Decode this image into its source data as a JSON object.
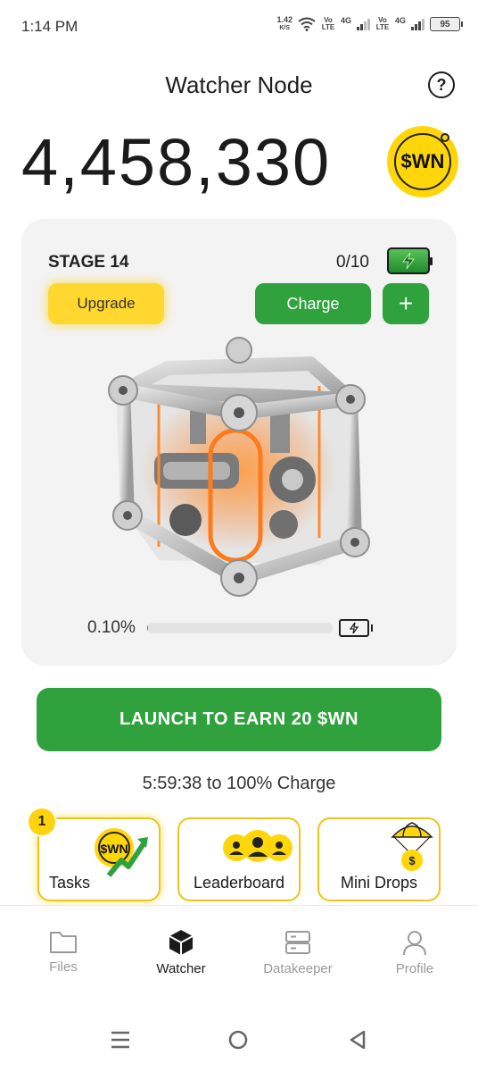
{
  "status_bar": {
    "time": "1:14 PM",
    "net_speed_value": "1.42",
    "net_speed_unit": "K/S",
    "sim1_volte": "Vo LTE",
    "sim1_network": "4G",
    "sim2_volte": "Vo LTE",
    "sim2_network": "4G",
    "battery_level": "95"
  },
  "header": {
    "title": "Watcher Node",
    "help_icon": "question-circle-icon"
  },
  "balance": {
    "amount": "4,458,330",
    "token_symbol": "$WN"
  },
  "stage_card": {
    "stage_label": "STAGE 14",
    "charges": "0/10",
    "upgrade_label": "Upgrade",
    "charge_label": "Charge",
    "plus_label": "+",
    "progress_text": "0.10%",
    "progress_value": 0.1
  },
  "launch": {
    "label": "LAUNCH TO EARN 20 $WN"
  },
  "charge_timer": "5:59:38 to 100% Charge",
  "tiles": {
    "tasks": {
      "label": "Tasks",
      "badge": "1",
      "icon_text": "$WN"
    },
    "leaderboard": {
      "label": "Leaderboard"
    },
    "mini_drops": {
      "label": "Mini Drops",
      "icon_text": "$"
    }
  },
  "bottom_nav": {
    "items": [
      {
        "label": "Files",
        "icon": "folder-icon",
        "active": false
      },
      {
        "label": "Watcher",
        "icon": "cube-icon",
        "active": true
      },
      {
        "label": "Datakeeper",
        "icon": "server-icon",
        "active": false
      },
      {
        "label": "Profile",
        "icon": "user-icon",
        "active": false
      }
    ]
  },
  "colors": {
    "accent_green": "#2fa23d",
    "accent_yellow": "#ffd72e",
    "card_bg": "#f3f3f3"
  }
}
